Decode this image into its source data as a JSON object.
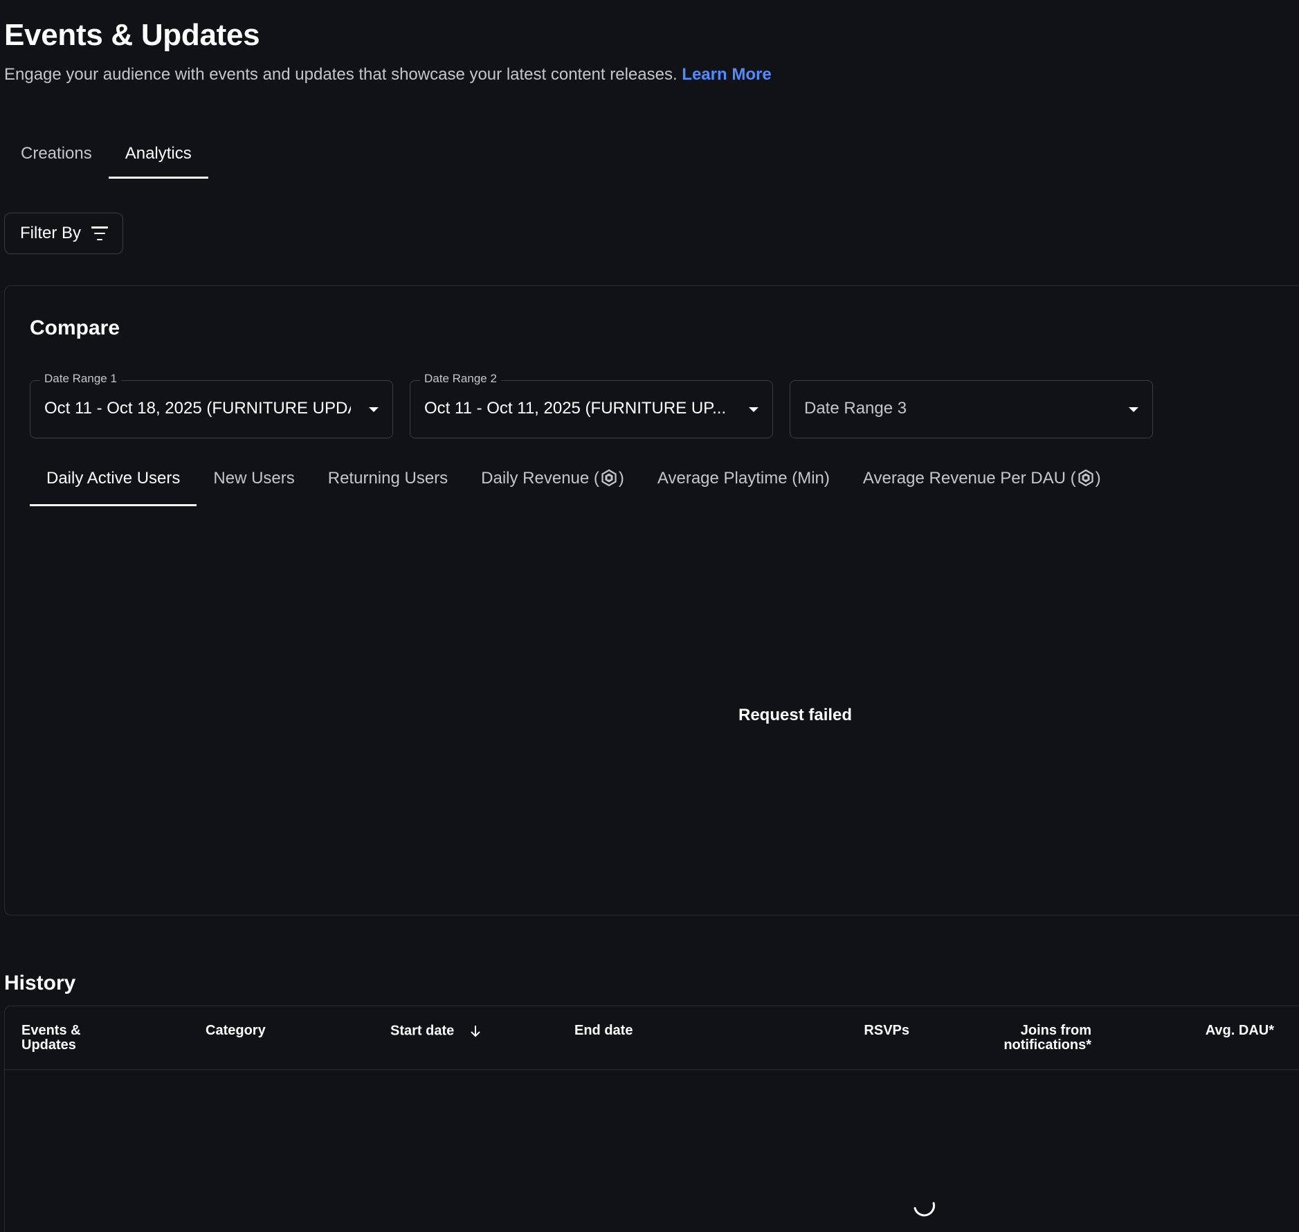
{
  "header": {
    "title": "Events & Updates",
    "subtitle": "Engage your audience with events and updates that showcase your latest content releases.",
    "learn_more": "Learn More"
  },
  "tabs": [
    {
      "label": "Creations",
      "active": false
    },
    {
      "label": "Analytics",
      "active": true
    }
  ],
  "filter": {
    "label": "Filter By",
    "icon": "filter-icon"
  },
  "compare": {
    "title": "Compare",
    "date_range_1": {
      "label": "Date Range 1",
      "value": "Oct 11 - Oct 18, 2025 (FURNITURE UPDA..."
    },
    "date_range_2": {
      "label": "Date Range 2",
      "value": "Oct 11 - Oct 11, 2025 (FURNITURE UP..."
    },
    "date_range_3": {
      "placeholder": "Date Range 3"
    },
    "metric_tabs": [
      {
        "label": "Daily Active Users",
        "active": true
      },
      {
        "label": "New Users",
        "active": false
      },
      {
        "label": "Returning Users",
        "active": false
      },
      {
        "label": "Daily Revenue (",
        "suffix": ")",
        "icon": "robux-icon",
        "active": false
      },
      {
        "label": "Average Playtime (Min)",
        "active": false
      },
      {
        "label": "Average Revenue Per DAU (",
        "suffix": ")",
        "icon": "robux-icon",
        "active": false
      }
    ],
    "error": "Request failed"
  },
  "history": {
    "title": "History",
    "columns": {
      "events": [
        "Events &",
        "Updates"
      ],
      "category": "Category",
      "start_date": "Start date",
      "end_date": "End date",
      "rsvps": "RSVPs",
      "joins": [
        "Joins from",
        "notifications*"
      ],
      "avg_dau": "Avg. DAU*"
    },
    "loading": true
  },
  "colors": {
    "background": "#111216",
    "accent_link": "#4f8cff",
    "border": "#3a3c44",
    "muted_text": "#c4c6cc"
  }
}
